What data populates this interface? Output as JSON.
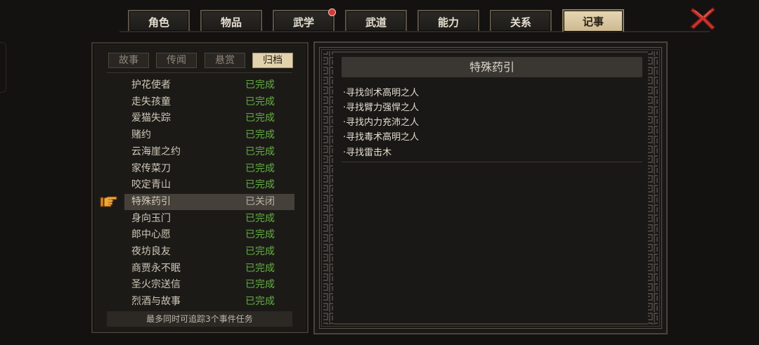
{
  "tabs": [
    {
      "label": "角色",
      "active": false,
      "badge": false
    },
    {
      "label": "物品",
      "active": false,
      "badge": false
    },
    {
      "label": "武学",
      "active": false,
      "badge": true
    },
    {
      "label": "武道",
      "active": false,
      "badge": false
    },
    {
      "label": "能力",
      "active": false,
      "badge": false
    },
    {
      "label": "关系",
      "active": false,
      "badge": false
    },
    {
      "label": "记事",
      "active": true,
      "badge": false
    }
  ],
  "close_icon": "close-x-icon",
  "subtabs": [
    {
      "label": "故事",
      "active": false
    },
    {
      "label": "传闻",
      "active": false
    },
    {
      "label": "悬赏",
      "active": false
    },
    {
      "label": "归档",
      "active": true
    }
  ],
  "quests": [
    {
      "name": "护花使者",
      "status": "已完成",
      "state": "done"
    },
    {
      "name": "走失孩童",
      "status": "已完成",
      "state": "done"
    },
    {
      "name": "爱猫失踪",
      "status": "已完成",
      "state": "done"
    },
    {
      "name": "赌约",
      "status": "已完成",
      "state": "done"
    },
    {
      "name": "云海崖之约",
      "status": "已完成",
      "state": "done"
    },
    {
      "name": "家传菜刀",
      "status": "已完成",
      "state": "done"
    },
    {
      "name": "咬定青山",
      "status": "已完成",
      "state": "done"
    },
    {
      "name": "特殊药引",
      "status": "已关闭",
      "state": "closed",
      "selected": true
    },
    {
      "name": "身向玉门",
      "status": "已完成",
      "state": "done"
    },
    {
      "name": "郎中心愿",
      "status": "已完成",
      "state": "done"
    },
    {
      "name": "夜坊良友",
      "status": "已完成",
      "state": "done"
    },
    {
      "name": "商贾永不眠",
      "status": "已完成",
      "state": "done"
    },
    {
      "name": "圣火宗送信",
      "status": "已完成",
      "state": "done"
    },
    {
      "name": "烈酒与故事",
      "status": "已完成",
      "state": "done"
    }
  ],
  "track_hint": "最多同时可追踪3个事件任务",
  "detail": {
    "title": "特殊药引",
    "requirements": [
      "·寻找剑术高明之人",
      "·寻找臂力强悍之人",
      "·寻找内力充沛之人",
      "·寻找毒术高明之人",
      "·寻找雷击木"
    ]
  },
  "colors": {
    "done": "#62b042",
    "closed": "#b8b2a6",
    "tab_active": "#e2d3ae",
    "close_red": "#c8322c"
  }
}
